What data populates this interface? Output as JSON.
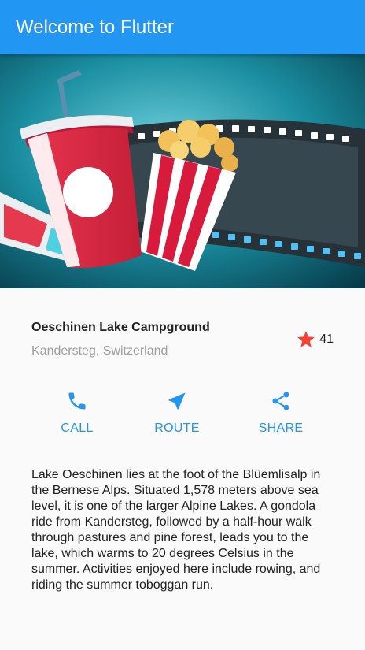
{
  "app_bar": {
    "title": "Welcome to Flutter"
  },
  "banner": {
    "image_name": "movie-snacks-image"
  },
  "place": {
    "name": "Oeschinen Lake Campground",
    "location": "Kandersteg, Switzerland",
    "rating_icon": "star-icon",
    "rating_count": "41"
  },
  "actions": [
    {
      "label": "CALL",
      "icon": "phone-icon"
    },
    {
      "label": "ROUTE",
      "icon": "navigation-icon"
    },
    {
      "label": "SHARE",
      "icon": "share-icon"
    }
  ],
  "description": "Lake Oeschinen lies at the foot of the Blüemlisalp in the Bernese Alps. Situated 1,578 meters above sea level, it is one of the larger Alpine Lakes. A gondola ride from Kandersteg, followed by a half-hour walk through pastures and pine forest, leads you to the lake, which warms to 20 degrees Celsius in the summer. Activities enjoyed here include rowing, and riding the summer toboggan run.",
  "colors": {
    "primary": "#2196f3",
    "star": "#f44336",
    "secondary_text": "#9e9e9e"
  }
}
